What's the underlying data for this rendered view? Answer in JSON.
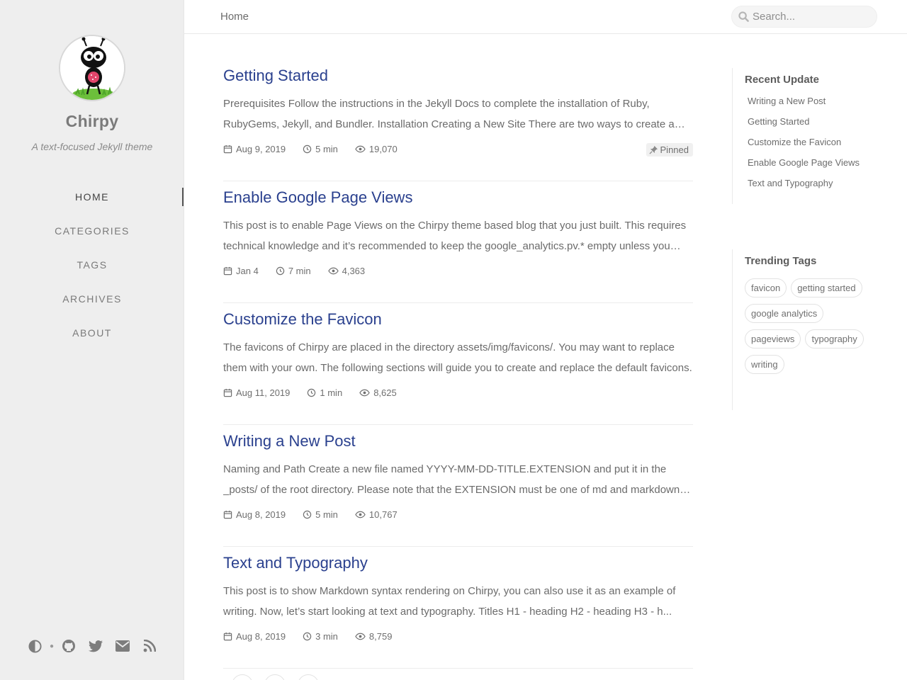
{
  "site": {
    "title": "Chirpy",
    "subtitle": "A text-focused Jekyll theme"
  },
  "nav": {
    "items": [
      {
        "label": "HOME",
        "active": true
      },
      {
        "label": "CATEGORIES",
        "active": false
      },
      {
        "label": "TAGS",
        "active": false
      },
      {
        "label": "ARCHIVES",
        "active": false
      },
      {
        "label": "ABOUT",
        "active": false
      }
    ]
  },
  "sidebar_bottom": {
    "icons": [
      "theme-toggle-icon",
      "github-icon",
      "twitter-icon",
      "email-icon",
      "rss-icon"
    ]
  },
  "topbar": {
    "breadcrumb": "Home",
    "search_placeholder": "Search..."
  },
  "posts": [
    {
      "title": "Getting Started",
      "excerpt": "Prerequisites Follow the instructions in the Jekyll Docs to complete the installation of Ruby, RubyGems, Jekyll, and Bundler. Installation Creating a New Site There are two ways to create a new repository for this theme.",
      "date": "Aug 9, 2019",
      "read_time": "5 min",
      "views": "19,070",
      "pinned_label": "Pinned"
    },
    {
      "title": "Enable Google Page Views",
      "excerpt": "This post is to enable Page Views on the Chirpy theme based blog that you just built. This requires technical knowledge and it’s recommended to keep the google_analytics.pv.* empty unless you have a good reason.",
      "date": "Jan 4",
      "read_time": "7 min",
      "views": "4,363"
    },
    {
      "title": "Customize the Favicon",
      "excerpt": "The favicons of Chirpy are placed in the directory assets/img/favicons/. You may want to replace them with your own. The following sections will guide you to create and replace the default favicons.",
      "date": "Aug 11, 2019",
      "read_time": "1 min",
      "views": "8,625"
    },
    {
      "title": "Writing a New Post",
      "excerpt": "Naming and Path Create a new file named YYYY-MM-DD-TITLE.EXTENSION and put it in the _posts/ of the root directory. Please note that the EXTENSION must be one of md and markdown. Front Matter",
      "date": "Aug 8, 2019",
      "read_time": "5 min",
      "views": "10,767"
    },
    {
      "title": "Text and Typography",
      "excerpt": "This post is to show Markdown syntax rendering on Chirpy, you can also use it as an example of writing. Now, let’s start looking at text and typography. Titles H1 - heading H2 - heading H3 - h...",
      "date": "Aug 8, 2019",
      "read_time": "3 min",
      "views": "8,759"
    }
  ],
  "recent_update": {
    "heading": "Recent Update",
    "items": [
      "Writing a New Post",
      "Getting Started",
      "Customize the Favicon",
      "Enable Google Page Views",
      "Text and Typography"
    ]
  },
  "trending_tags": {
    "heading": "Trending Tags",
    "items": [
      "favicon",
      "getting started",
      "google analytics",
      "pageviews",
      "typography",
      "writing"
    ]
  },
  "colors": {
    "link": "#2a408e",
    "sidebar_bg": "#eeeeee"
  }
}
